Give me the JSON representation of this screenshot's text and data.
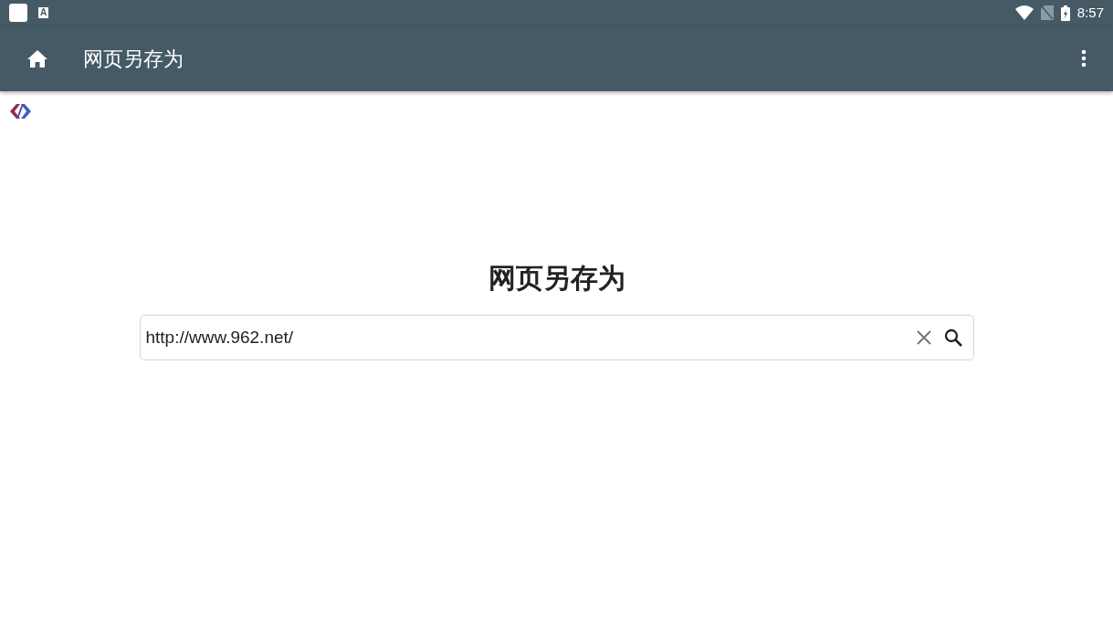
{
  "status_bar": {
    "notification_glyph": "A",
    "time": "8:57"
  },
  "app_bar": {
    "title": "网页另存为"
  },
  "main": {
    "heading": "网页另存为",
    "url_field": {
      "value": "http://www.962.net/"
    }
  }
}
